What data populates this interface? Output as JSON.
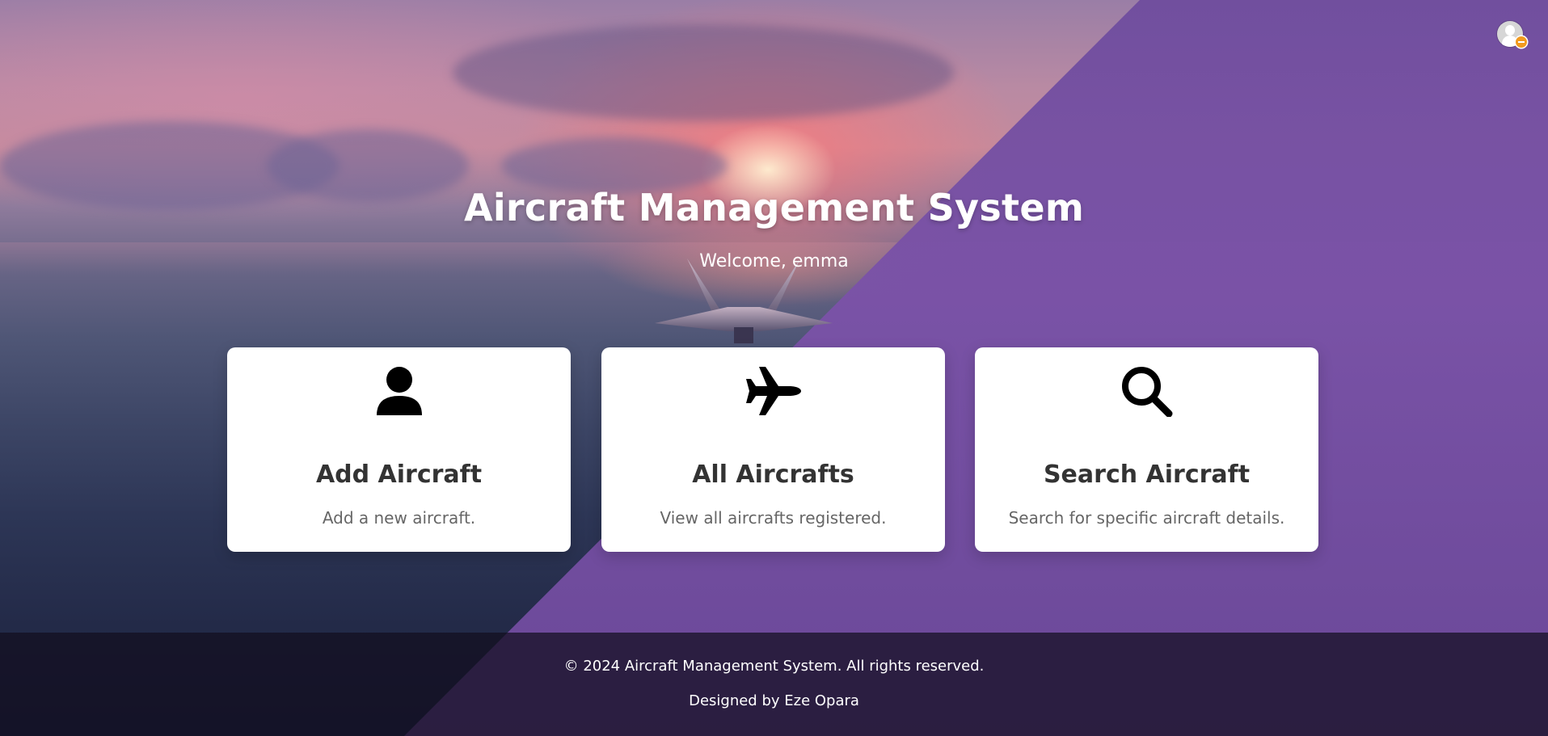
{
  "header": {
    "title": "Aircraft Management System",
    "welcome": "Welcome, emma"
  },
  "profile": {
    "icon": "user-avatar-icon",
    "badge_icon": "minus-badge-icon",
    "badge_color": "#f29a1f"
  },
  "cards": [
    {
      "icon": "user-icon",
      "title": "Add Aircraft",
      "description": "Add a new aircraft."
    },
    {
      "icon": "plane-icon",
      "title": "All Aircrafts",
      "description": "View all aircrafts registered."
    },
    {
      "icon": "search-icon",
      "title": "Search Aircraft",
      "description": "Search for specific aircraft details."
    }
  ],
  "footer": {
    "copyright": "© 2024 Aircraft Management System. All rights reserved.",
    "designer": "Designed by Eze Opara"
  },
  "colors": {
    "accent_purple": "#7b52a8",
    "card_bg": "#ffffff",
    "title_text": "#333333",
    "desc_text": "#666666"
  }
}
